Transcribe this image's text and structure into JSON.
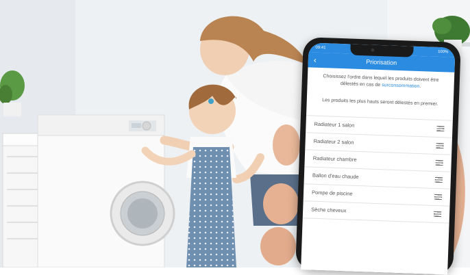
{
  "screen": {
    "status_bar": {
      "time": "09:41",
      "battery": "100%"
    },
    "header": {
      "title": "Priorisation",
      "back_icon": "chevron-left-icon"
    },
    "intro": {
      "text_before": "Choisissez l'ordre dans lequel les produits doivent être délestés en cas de ",
      "link_text": "surconsommation",
      "text_after": "."
    },
    "note": "Les produits les plus hauts seront délestés en premier.",
    "items": [
      {
        "label": "Radiateur 1 salon"
      },
      {
        "label": "Radiateur 2 salon"
      },
      {
        "label": "Radiateur chambre"
      },
      {
        "label": "Ballon d'eau chaude"
      },
      {
        "label": "Pompe de piscine"
      },
      {
        "label": "Sèche cheveux"
      }
    ],
    "drag_icon": "drag-handle-icon"
  },
  "colors": {
    "accent": "#2a8be0",
    "text": "#555555",
    "divider": "#e2e2e2"
  }
}
